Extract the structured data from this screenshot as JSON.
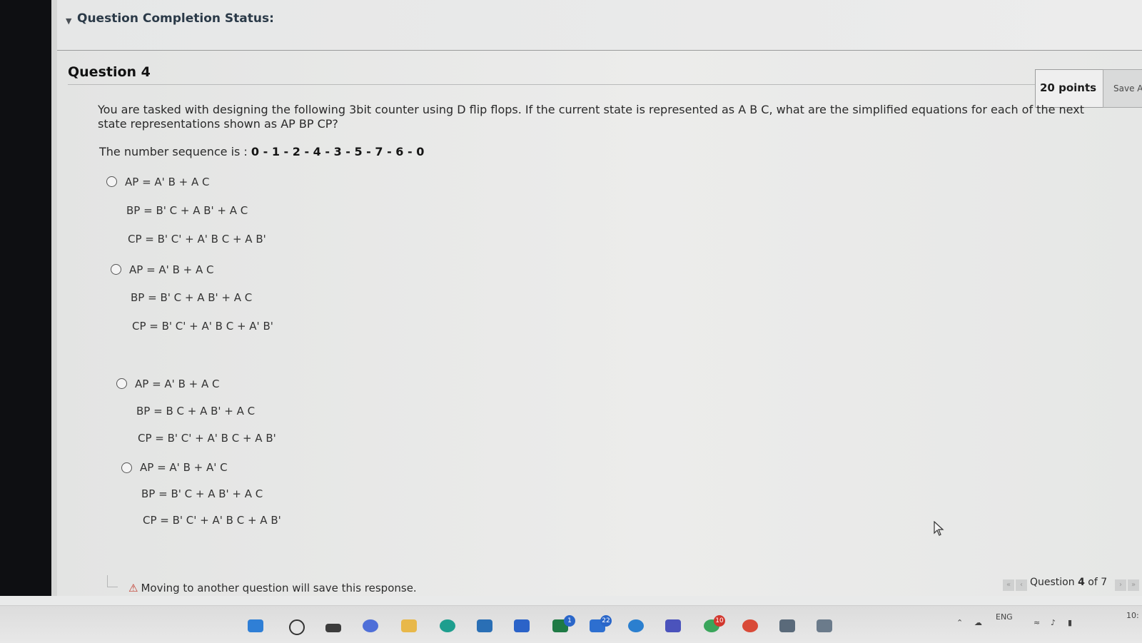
{
  "header": {
    "completion_status_label": "Question Completion Status:"
  },
  "question": {
    "title": "Question 4",
    "points": "20 points",
    "save_label": "Save A",
    "prompt": "You are tasked with designing the following 3bit counter using D flip flops. If the current state is represented as A B C, what are the simplified equations for each of the next state representations shown as AP BP CP?",
    "sequence_label": "The number sequence is : ",
    "sequence_value": "0 - 1 - 2 - 4 - 3 - 5 - 7 - 6 - 0",
    "options": [
      {
        "ap": "AP = A' B + A C",
        "bp": "BP = B' C + A B' + A C",
        "cp": "CP = B' C' + A' B C + A B'"
      },
      {
        "ap": "AP = A' B + A C",
        "bp": "BP = B' C + A B' + A C",
        "cp": "CP = B' C' + A' B C + A' B'"
      },
      {
        "ap": "AP = A' B + A C",
        "bp": "BP = B C + A B' + A C",
        "cp": "CP = B' C' + A' B C + A B'"
      },
      {
        "ap": "AP = A' B + A' C",
        "bp": "BP = B' C + A B' + A C",
        "cp": "CP = B' C' + A' B C + A B'"
      }
    ]
  },
  "footer": {
    "warning": "Moving to another question will save this response.",
    "nav_prefix": "Question ",
    "nav_current": "4",
    "nav_suffix": " of 7"
  },
  "taskbar": {
    "badges": [
      "1",
      "22",
      "10"
    ],
    "language": "ENG",
    "clock_partial": "10:"
  },
  "colors": {
    "bezel": "#0e0f12",
    "page_bg": "#e9eaea",
    "status_title": "#2b3a48",
    "warning_icon": "#c0392b"
  }
}
